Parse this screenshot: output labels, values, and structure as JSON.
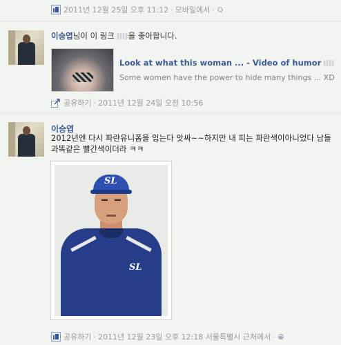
{
  "feed": {
    "top_item": {
      "timestamp": "2011년 12월 25일 오후 11:12",
      "source": "모바일에서",
      "privacy_icon": "gear-icon"
    },
    "like_story": {
      "actor": "이승엽",
      "action_prefix": "님이 이 링크",
      "action_suffix": "을 좋아합니다.",
      "link": {
        "title": "Look at what this woman ... - Video of humor",
        "description": "Some women have the power to hide many things ... XD"
      },
      "share_label": "공유하기",
      "timestamp": "2011년 12월 24일 오전 10:56"
    },
    "status_post": {
      "author": "이승엽",
      "text": "2012년엔 다시 파란유니폼을 입는다 앗싸~~하지만 내 피는 파란색이아니었다 남들과똑같은 빨간색이더라 ㅋㅋ",
      "photo_cap_logo": "SL",
      "photo_jersey_logo": "SL",
      "share_label": "공유하기",
      "timestamp": "2011년 12월 23일 오후 12:18",
      "location": "서울특별시 근처에서",
      "privacy_icon": "globe-icon"
    }
  }
}
